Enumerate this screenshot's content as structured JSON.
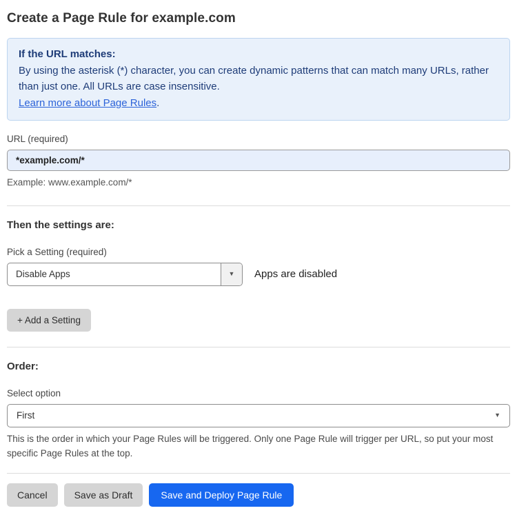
{
  "page": {
    "title": "Create a Page Rule for example.com"
  },
  "info_box": {
    "heading": "If the URL matches:",
    "body": "By using the asterisk (*) character, you can create dynamic patterns that can match many URLs, rather than just one. All URLs are case insensitive.",
    "link_text": "Learn more about Page Rules",
    "link_suffix": "."
  },
  "url_field": {
    "label": "URL (required)",
    "value": "*example.com/*",
    "helper": "Example: www.example.com/*"
  },
  "settings_section": {
    "heading": "Then the settings are:",
    "picker_label": "Pick a Setting (required)",
    "picker_value": "Disable Apps",
    "picker_caret": "▼",
    "status_text": "Apps are disabled",
    "add_button_label": "+ Add a Setting"
  },
  "order_section": {
    "heading": "Order:",
    "select_label": "Select option",
    "select_value": "First",
    "select_caret": "▼",
    "helper": "This is the order in which your Page Rules will be triggered. Only one Page Rule will trigger per URL, so put your most specific Page Rules at the top."
  },
  "footer": {
    "cancel_label": "Cancel",
    "save_draft_label": "Save as Draft",
    "save_deploy_label": "Save and Deploy Page Rule"
  },
  "colors": {
    "info_box_bg": "#e9f1fb",
    "info_box_border": "#bcd4f0",
    "info_box_text": "#1e3c78",
    "link_blue": "#2c63d9",
    "url_input_bg": "#e7effc",
    "primary_button_blue": "#1767f0",
    "secondary_button_gray": "#d5d5d5"
  }
}
